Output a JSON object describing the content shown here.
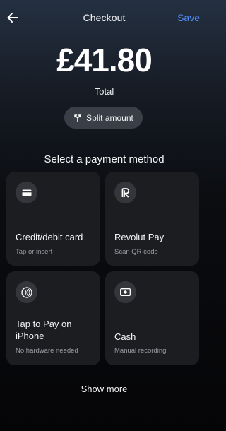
{
  "header": {
    "title": "Checkout",
    "save_label": "Save",
    "back_icon": "arrow-left-icon"
  },
  "total": {
    "amount": "£41.80",
    "label": "Total"
  },
  "split": {
    "label": "Split amount",
    "icon": "split-icon"
  },
  "payment": {
    "section_title": "Select a payment method",
    "methods": [
      {
        "title": "Credit/debit card",
        "subtitle": "Tap or insert",
        "icon": "card-icon"
      },
      {
        "title": "Revolut Pay",
        "subtitle": "Scan QR code",
        "icon": "revolut-logo-icon"
      },
      {
        "title": "Tap to Pay on iPhone",
        "subtitle": "No hardware needed",
        "icon": "contactless-icon"
      },
      {
        "title": "Cash",
        "subtitle": "Manual recording",
        "icon": "cash-icon"
      }
    ]
  },
  "show_more_label": "Show more",
  "colors": {
    "accent": "#4f8df7",
    "card_bg": "#1c1d20",
    "icon_circle": "#34363b",
    "split_bg": "#3a3f47"
  }
}
